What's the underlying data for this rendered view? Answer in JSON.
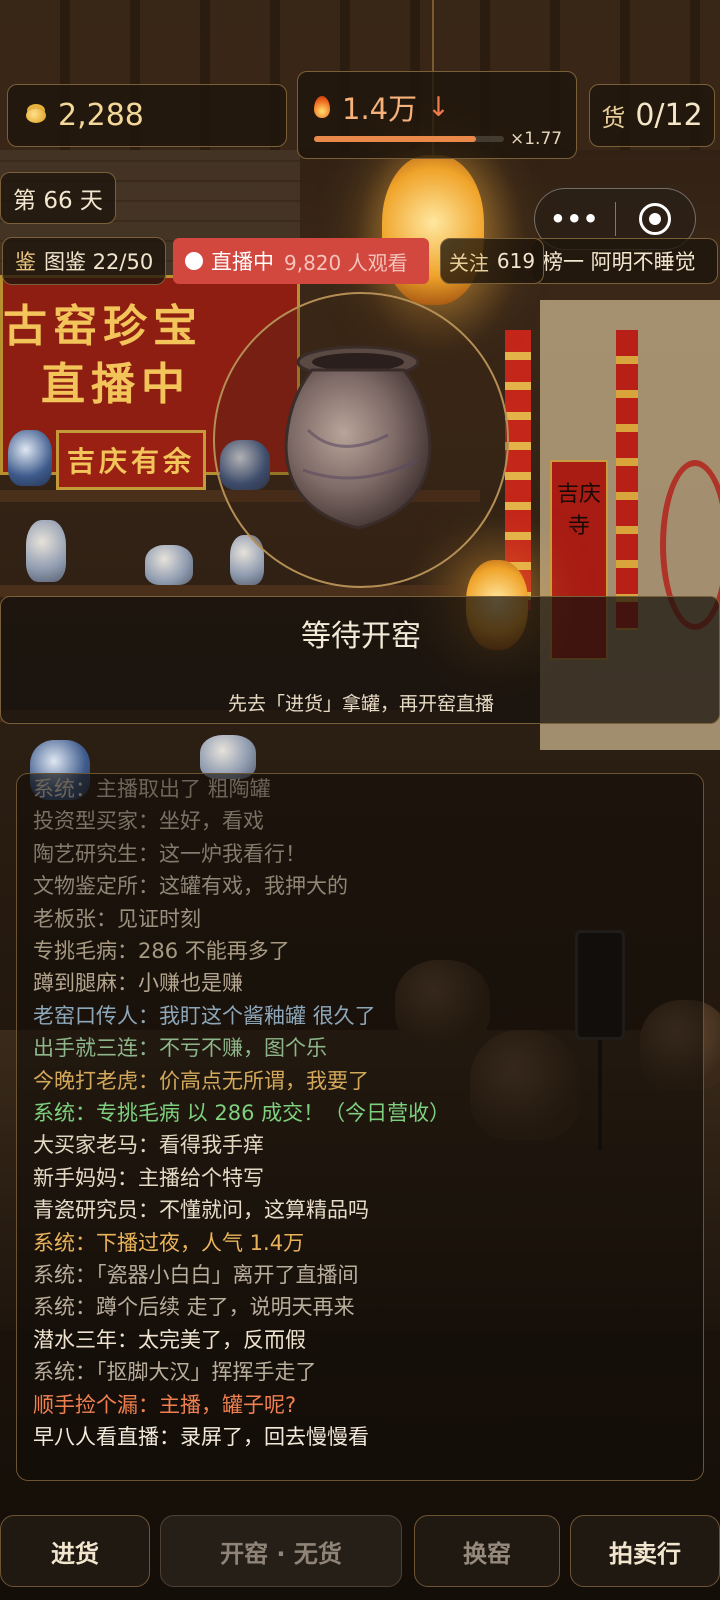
{
  "hud": {
    "coins": "2,288",
    "heat": "1.4万",
    "heat_arrow": "↓",
    "heat_multiplier": "×1.77",
    "heat_level": 0.85,
    "goods_label": "货",
    "goods_value": "0/12",
    "day": "第 66 天"
  },
  "capsule": {
    "more": "•••"
  },
  "status": {
    "catalog_key": "鉴",
    "catalog": "图鉴 22/50",
    "live_label": "直播中",
    "viewers": "9,820 人观看",
    "follow_key": "关注",
    "follow_value": "619",
    "rank": "榜一 阿明不睡觉"
  },
  "scene": {
    "banner_line1": "古窑珍宝",
    "banner_line2": "直播中",
    "sign": "吉庆有余",
    "scroll": "吉庆寺"
  },
  "kiln_panel": {
    "title": "等待开窑",
    "subtitle": "先去「进货」拿罐，再开窑直播"
  },
  "chat": [
    {
      "text": "系统：主播取出了 粗陶罐",
      "color": "#6e6558"
    },
    {
      "text": "投资型买家：坐好，看戏",
      "color": "#7a7063"
    },
    {
      "text": "陶艺研究生：这一炉我看行！",
      "color": "#857a6b"
    },
    {
      "text": "文物鉴定所：这罐有戏，我押大的",
      "color": "#908474"
    },
    {
      "text": "老板张：见证时刻",
      "color": "#9c8f7d"
    },
    {
      "text": "专挑毛病：286 不能再多了",
      "color": "#a89982"
    },
    {
      "text": "蹲到腿麻：小赚也是赚",
      "color": "#b4a58e"
    },
    {
      "text": "老窑口传人：我盯这个酱釉罐 很久了",
      "color": "#8da7b9"
    },
    {
      "text": "出手就三连：不亏不赚，图个乐",
      "color": "#8fb68a"
    },
    {
      "text": "今晚打老虎：价高点无所谓，我要了",
      "color": "#d3a85a"
    },
    {
      "text": "系统：专挑毛病 以 286 成交！（今日营收）",
      "color": "#7ed07e"
    },
    {
      "text": "大买家老马：看得我手痒",
      "color": "#e4d8c3"
    },
    {
      "text": "新手妈妈：主播给个特写",
      "color": "#e6dac6"
    },
    {
      "text": "青瓷研究员：不懂就问，这算精品吗",
      "color": "#e8dcc8"
    },
    {
      "text": "系统：下播过夜，人气 1.4万",
      "color": "#e8b35a"
    },
    {
      "text": "系统：「瓷器小白白」离开了直播间",
      "color": "#b9ad9c"
    },
    {
      "text": "系统：蹲个后续 走了，说明天再来",
      "color": "#b9ad9c"
    },
    {
      "text": "潜水三年：太完美了，反而假",
      "color": "#efe3cf"
    },
    {
      "text": "系统：「抠脚大汉」挥挥手走了",
      "color": "#b9ad9c"
    },
    {
      "text": "顺手捡个漏：主播，罐子呢?",
      "color": "#f08050"
    },
    {
      "text": "早八人看直播：录屏了，回去慢慢看",
      "color": "#f3eadb"
    }
  ],
  "buttons": {
    "stock": "进货",
    "kiln": "开窑 · 无货",
    "swap": "换窑",
    "auction": "拍卖行"
  }
}
